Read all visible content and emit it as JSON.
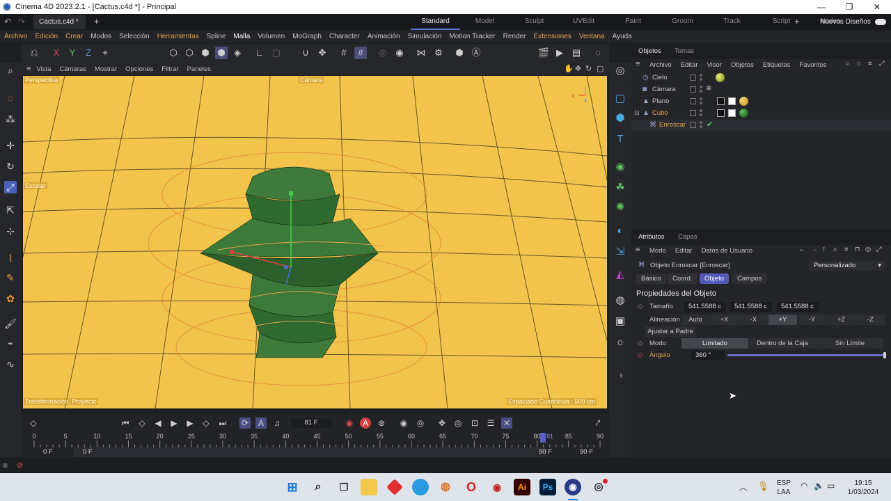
{
  "window": {
    "title": "Cinema 4D 2023.2.1 - [Cactus.c4d *] - Principal"
  },
  "doc_tab": {
    "label": "Cactus.c4d *"
  },
  "layouts": [
    "Standard",
    "Model",
    "Sculpt",
    "UVEdit",
    "Paint",
    "Groom",
    "Track",
    "Script",
    "Nodes"
  ],
  "new_layouts": "Nuevos Diseños",
  "menu": [
    "Archivo",
    "Edición",
    "Crear",
    "Modos",
    "Selección",
    "Herramientas",
    "Spline",
    "Malla",
    "Volumen",
    "MoGraph",
    "Character",
    "Animación",
    "Simulación",
    "Motion Tracker",
    "Render",
    "Extensiones",
    "Ventana",
    "Ayuda"
  ],
  "viewport": {
    "menu": [
      "Vista",
      "Cámaras",
      "Mostrar",
      "Opciones",
      "Filtrar",
      "Paneles"
    ],
    "projection": "Perspectiva",
    "camera": "Cámara",
    "tool_label": "Escalar",
    "transform_label": "Transformación, Proyecto",
    "grid_label": "Espaciado Cuadrícula : 500 cm",
    "bg_color": "#f2c44b"
  },
  "objects_panel": {
    "tabs": [
      "Objetos",
      "Tomas"
    ],
    "menu": [
      "Archivo",
      "Editar",
      "Visor",
      "Objetos",
      "Etiquetas",
      "Favoritos"
    ],
    "rows": [
      {
        "name": "Cielo",
        "icon": "sky-icon"
      },
      {
        "name": "Cámara",
        "icon": "camera-icon"
      },
      {
        "name": "Plano",
        "icon": "plane-icon"
      },
      {
        "name": "Cubo",
        "icon": "cube-icon"
      },
      {
        "name": "Enroscar",
        "icon": "twist-deformer-icon"
      }
    ]
  },
  "attributes_panel": {
    "tabs": [
      "Atributos",
      "Capas"
    ],
    "menu": [
      "Modo",
      "Editar",
      "Datos de Usuario"
    ],
    "object_title": "Objeto Enroscar [Enroscar]",
    "preset": "Personalizado",
    "subtabs": [
      "Básico",
      "Coord.",
      "Objeto",
      "Campos"
    ],
    "section": "Propiedades del Objeto",
    "size_label": "Tamaño",
    "size_values": [
      "541.5588 c",
      "541.5588 c",
      "541.5588 c"
    ],
    "align_label": "Alineación",
    "align_options": [
      "Auto",
      "+X",
      "-X",
      "+Y",
      "-Y",
      "+Z",
      "-Z"
    ],
    "fit_parent": "Ajustar a Padre",
    "mode_label": "Modo",
    "mode_options": [
      "Limitado",
      "Dentro de la Caja",
      "Sin Límite"
    ],
    "angle_label": "Ángulo",
    "angle_value": "360 °",
    "angle_fraction": 1.0
  },
  "timeline": {
    "current_frame": "81 F",
    "ruler": [
      "0",
      "5",
      "10",
      "15",
      "20",
      "25",
      "30",
      "35",
      "40",
      "45",
      "50",
      "55",
      "60",
      "65",
      "70",
      "75",
      "80",
      "85",
      "90"
    ],
    "playhead": "81",
    "start_a": "0 F",
    "start_b": "0 F",
    "end_a": "90 F",
    "end_b": "90 F"
  },
  "taskbar": {
    "lang": "ESP",
    "layout": "LAA",
    "time": "19:15",
    "date": "1/03/2024"
  }
}
